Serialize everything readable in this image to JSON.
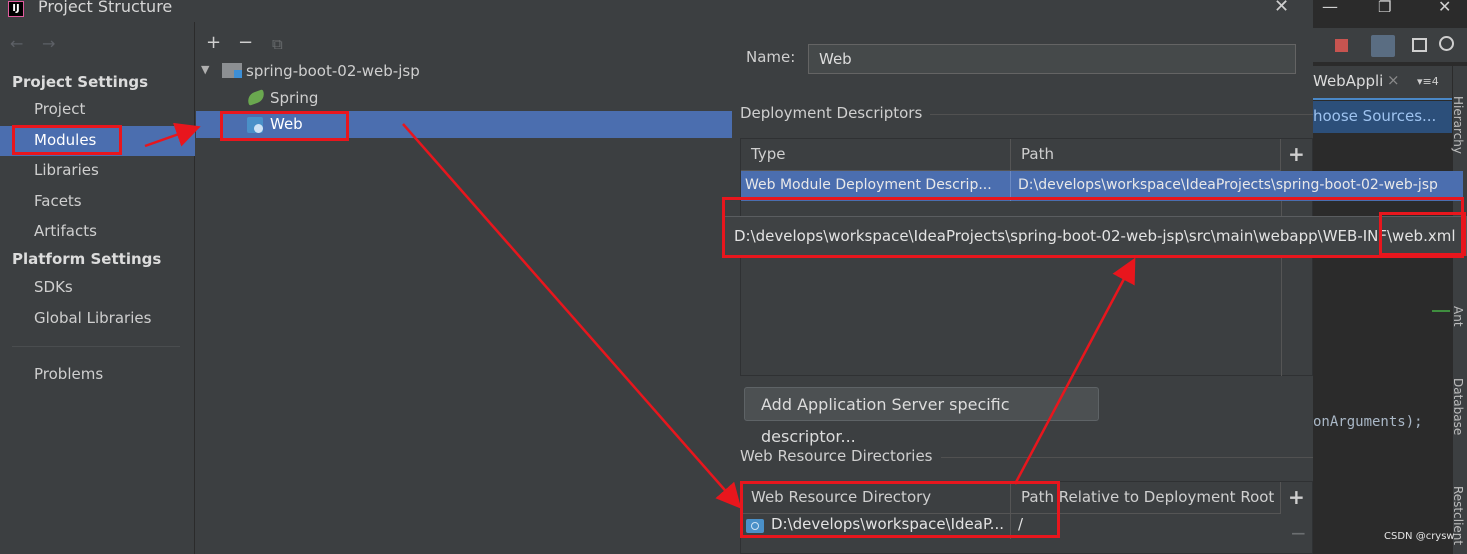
{
  "window": {
    "title": "Project Structure",
    "close_glyph": "✕"
  },
  "nav": {
    "back_glyph": "←",
    "forward_glyph": "→",
    "project_settings_header": "Project Settings",
    "platform_settings_header": "Platform Settings",
    "items": {
      "project": "Project",
      "modules": "Modules",
      "libraries": "Libraries",
      "facets": "Facets",
      "artifacts": "Artifacts",
      "sdks": "SDKs",
      "global_libraries": "Global Libraries",
      "problems": "Problems"
    },
    "selected": "Modules"
  },
  "tree": {
    "add_glyph": "+",
    "remove_glyph": "−",
    "copy_glyph": "⧉",
    "expand_glyph": "▼",
    "root": "spring-boot-02-web-jsp",
    "children": [
      "Spring",
      "Web"
    ],
    "selected": "Web"
  },
  "facet": {
    "name_label": "Name:",
    "name_value": "Web",
    "deployment_descriptors": {
      "title": "Deployment Descriptors",
      "col_type": "Type",
      "col_path": "Path",
      "row_type": "Web Module Deployment Descrip...",
      "row_path": "D:\\develops\\workspace\\IdeaProjects\\spring-boot-02-web-jsp",
      "tooltip": "D:\\develops\\workspace\\IdeaProjects\\spring-boot-02-web-jsp\\src\\main\\webapp\\WEB-INF\\web.xml"
    },
    "add_server_descriptor_button": "Add Application Server specific descriptor...",
    "web_resource_directories": {
      "title": "Web Resource Directories",
      "col_dir": "Web Resource Directory",
      "col_rel": "Path Relative to Deployment Root",
      "row_dir": "D:\\develops\\workspace\\IdeaP...",
      "row_rel": "/"
    }
  },
  "ide_background": {
    "tab_label": "WebAppli",
    "tab_close": "×",
    "tab_menu": "▾≡4",
    "choose_sources": "hoose Sources...",
    "code_fragment": "onArguments);",
    "side_labels": [
      "Hierarchy",
      "Ant",
      "Database",
      "Restclient"
    ],
    "window_controls": [
      "—",
      "❐",
      "✕"
    ]
  },
  "watermark": "CSDN @crysw",
  "colors": {
    "selection": "#4b6eaf",
    "panel_bg": "#3c3f41",
    "annotation_red": "#e8161d"
  }
}
